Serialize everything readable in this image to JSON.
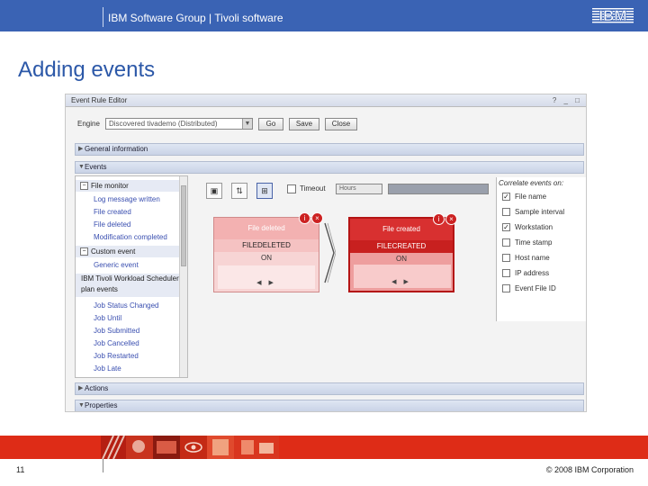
{
  "header": {
    "group_text": "IBM Software Group | Tivoli software",
    "logo": "IBM"
  },
  "slide": {
    "title": "Adding events",
    "page_number": "11",
    "copyright": "© 2008 IBM Corporation"
  },
  "window": {
    "title": "Event Rule Editor",
    "controls": "? _ □"
  },
  "engine": {
    "label": "Engine",
    "value": "Discovered  tivademo (Distributed)",
    "go_label": "Go",
    "save_label": "Save",
    "close_label": "Close"
  },
  "sections": {
    "general": "General information",
    "events": "Events",
    "actions": "Actions",
    "properties": "Properties"
  },
  "tree": {
    "file_monitor": "File monitor",
    "file_monitor_items": [
      "Log message written",
      "File created",
      "File deleted",
      "Modification completed"
    ],
    "custom_event": "Custom event",
    "custom_event_items": [
      "Generic event"
    ],
    "workload": "IBM Tivoli Workload Scheduler plan events",
    "workload_items": [
      "Job Status Changed",
      "Job Until",
      "Job Submitted",
      "Job Cancelled",
      "Job Restarted",
      "Job Late"
    ]
  },
  "canvas": {
    "timeout_label": "Timeout",
    "hours_value": "Hours",
    "events": [
      {
        "name": "File deleted",
        "code": "FILEDELETED",
        "status": "ON",
        "selected": false
      },
      {
        "name": "File created",
        "code": "FILECREATED",
        "status": "ON",
        "selected": true
      }
    ],
    "nav": "◀ ▶",
    "ctl_info": "i",
    "ctl_close": "×"
  },
  "correlate": {
    "header": "Correlate events on:",
    "attributes": [
      {
        "label": "File name",
        "checked": true
      },
      {
        "label": "Sample interval",
        "checked": false
      },
      {
        "label": "Workstation",
        "checked": true
      },
      {
        "label": "Time stamp",
        "checked": false
      },
      {
        "label": "Host name",
        "checked": false
      },
      {
        "label": "IP address",
        "checked": false
      },
      {
        "label": "Event File ID",
        "checked": false
      }
    ]
  },
  "colors": {
    "header_blue": "#3a63b4",
    "title_blue": "#2c58a8",
    "footer_red": "#de2c17",
    "event_selected": "#d83030"
  }
}
